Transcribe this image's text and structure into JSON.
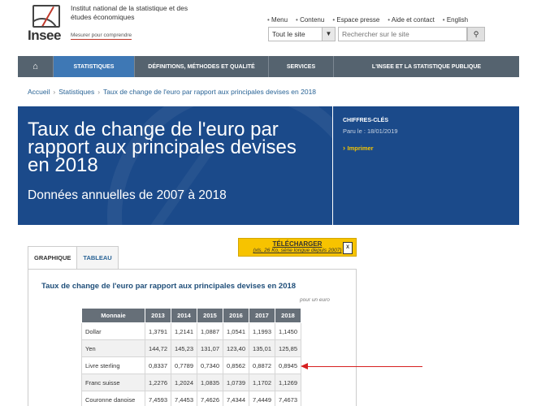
{
  "header": {
    "logo_text": "Insee",
    "institution": "Institut national de la statistique et des études économiques",
    "tagline": "Mesurer pour comprendre",
    "toplinks": [
      "Menu",
      "Contenu",
      "Espace presse",
      "Aide et contact",
      "English"
    ],
    "site_select": "Tout le site",
    "search_placeholder": "Rechercher sur le site"
  },
  "nav": {
    "home_icon": "home-icon",
    "items": [
      "STATISTIQUES",
      "DÉFINITIONS, MÉTHODES ET QUALITÉ",
      "SERVICES",
      "L'INSEE ET LA STATISTIQUE PUBLIQUE"
    ]
  },
  "breadcrumb": [
    "Accueil",
    "Statistiques",
    "Taux de change de l'euro par rapport aux principales devises en 2018"
  ],
  "banner": {
    "title": "Taux de change de l'euro par rapport aux principales devises en 2018",
    "subtitle": "Données annuelles de 2007 à 2018"
  },
  "side": {
    "kicker": "CHIFFRES-CLÉS",
    "published": "Paru le : 18/01/2019",
    "print": "Imprimer"
  },
  "tabs": [
    "GRAPHIQUE",
    "TABLEAU"
  ],
  "download": {
    "label": "TÉLÉCHARGER",
    "sub": "(xls, 26 Ko, série longue depuis 2007)"
  },
  "table": {
    "title": "Taux de change de l'euro par rapport aux principales devises en 2018",
    "unit": "pour un euro",
    "headers": [
      "Monnaie",
      "2013",
      "2014",
      "2015",
      "2016",
      "2017",
      "2018"
    ],
    "rows": [
      [
        "Dollar",
        "1,3791",
        "1,2141",
        "1,0887",
        "1,0541",
        "1,1993",
        "1,1450"
      ],
      [
        "Yen",
        "144,72",
        "145,23",
        "131,07",
        "123,40",
        "135,01",
        "125,85"
      ],
      [
        "Livre sterling",
        "0,8337",
        "0,7789",
        "0,7340",
        "0,8562",
        "0,8872",
        "0,8945"
      ],
      [
        "Franc suisse",
        "1,2276",
        "1,2024",
        "1,0835",
        "1,0739",
        "1,1702",
        "1,1269"
      ],
      [
        "Couronne danoise",
        "7,4593",
        "7,4453",
        "7,4626",
        "7,4344",
        "7,4449",
        "7,4673"
      ]
    ]
  }
}
